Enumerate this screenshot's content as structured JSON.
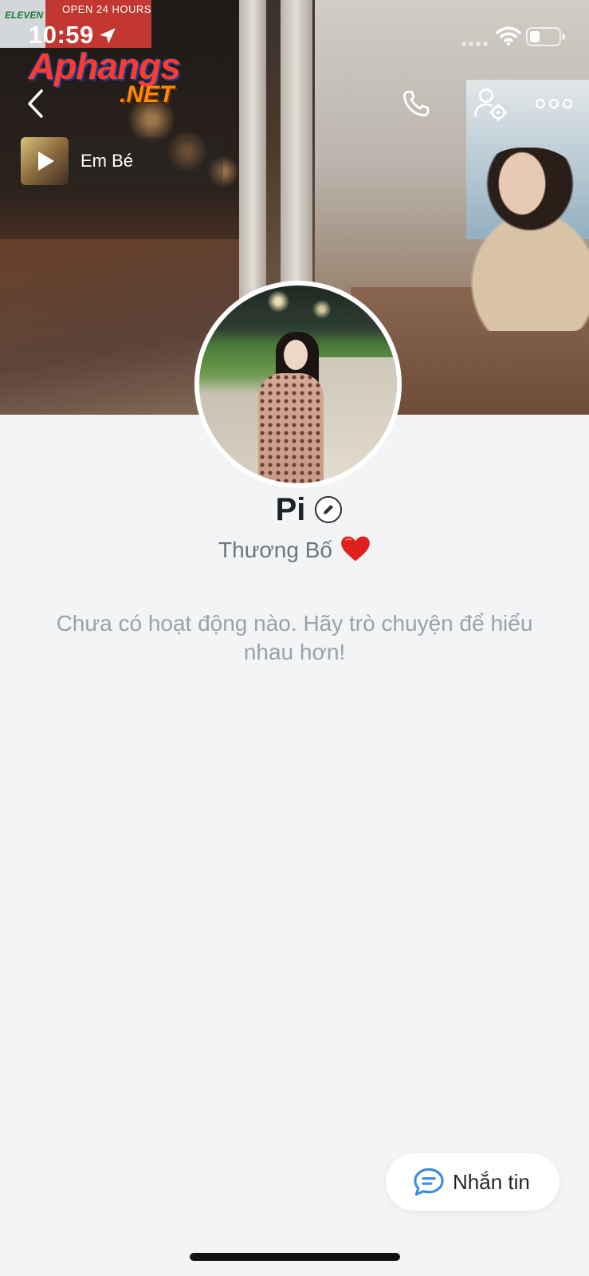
{
  "status_bar": {
    "time": "10:59",
    "icons": [
      "location-arrow-icon",
      "signal-dots-icon",
      "wifi-icon",
      "battery-icon"
    ]
  },
  "cover": {
    "sign_711": "ELEVEN",
    "sign_text": "OPEN 24 HOURS"
  },
  "watermark": {
    "main": "Aphangs",
    "sub": ".NET"
  },
  "header": {
    "icons": [
      "back-icon",
      "phone-icon",
      "profile-settings-icon",
      "more-icon"
    ]
  },
  "music": {
    "title": "Em Bé",
    "icon": "play-icon"
  },
  "profile": {
    "name": "Pi",
    "bio": "Thương Bố",
    "bio_emoji": "❤️",
    "empty_message": "Chưa có hoạt động nào. Hãy trò chuyện để hiểu nhau hơn!"
  },
  "actions": {
    "message_label": "Nhắn tin",
    "accent_color": "#3a8de0"
  }
}
